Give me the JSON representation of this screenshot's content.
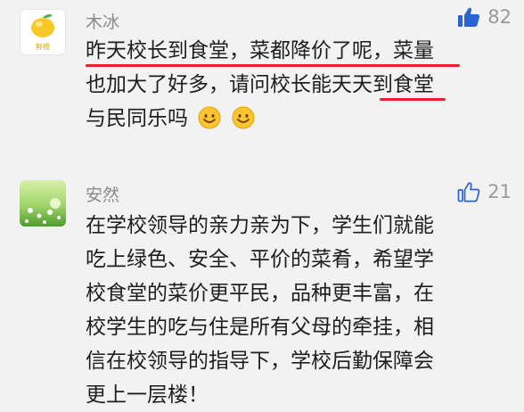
{
  "comments": [
    {
      "username": "木冰",
      "avatar_text": "鲜橙",
      "likes": "82",
      "like_icon": "thumbs-up-filled-icon",
      "lines": [
        "昨天校长到食堂，菜都降价了呢，菜量",
        "也加大了好多，请问校长能天天到食堂",
        "与民同乐吗"
      ],
      "emoji": [
        "smile-emoji-icon",
        "smile-emoji-icon"
      ]
    },
    {
      "username": "安然",
      "likes": "21",
      "like_icon": "thumbs-up-outline-icon",
      "lines": [
        "在学校领导的亲力亲为下，学生们就能",
        "吃上绿色、安全、平价的菜肴，希望学",
        "校食堂的菜价更平民，品种更丰富，在",
        "校学生的吃与住是所有父母的牵挂，相",
        "信在校领导的指导下，学校后勤保障会",
        "更上一层楼！"
      ]
    }
  ],
  "colors": {
    "background": "#f2f2f2",
    "username": "#8a8a8a",
    "body_text": "#1e1e1e",
    "like_active": "#2a63d6",
    "like_count": "#9a9a9a",
    "annotation_underline": "#e8222a"
  }
}
